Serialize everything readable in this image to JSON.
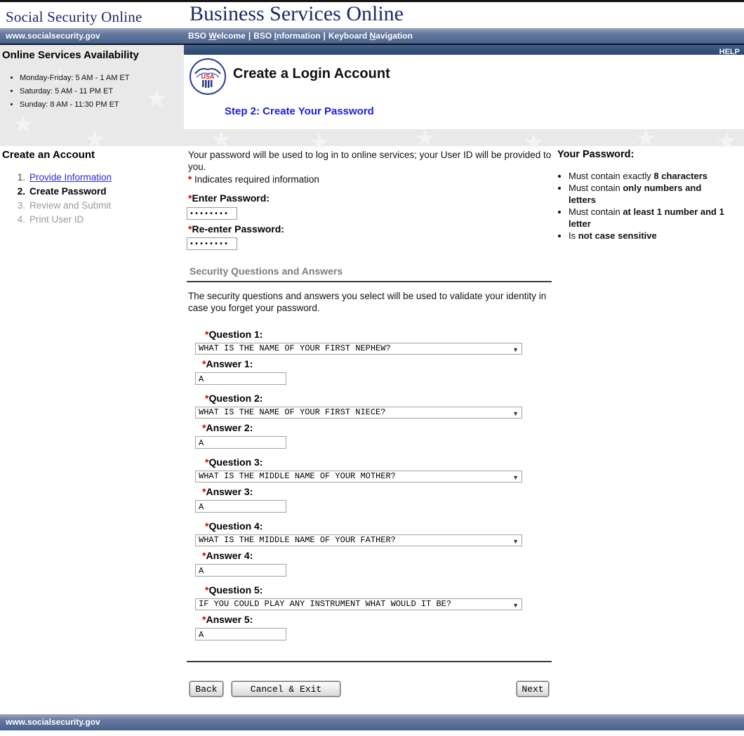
{
  "required_marker": "*",
  "header": {
    "site_name": "Social Security Online",
    "page_title": "Business Services Online",
    "site_url": "www.socialsecurity.gov",
    "nav_separator": "|",
    "nav_links": [
      {
        "pre": "BSO ",
        "key": "W",
        "post": "elcome"
      },
      {
        "pre": "BSO ",
        "key": "I",
        "post": "nformation"
      },
      {
        "pre": "Keyboard ",
        "key": "N",
        "post": "avigation"
      }
    ],
    "help_label": "HELP"
  },
  "availability": {
    "title": "Online Services Availability",
    "items": [
      "Monday-Friday: 5 AM - 1 AM ET",
      "Saturday: 5 AM - 11 PM ET",
      "Sunday: 8 AM - 11:30 PM ET"
    ]
  },
  "hero": {
    "title": "Create a Login Account",
    "step_title": "Step 2: Create Your Password",
    "seal_label": "USA"
  },
  "sidebar_steps": {
    "title": "Create an Account",
    "items": [
      {
        "num": "1.",
        "label": "Provide Information",
        "state": "link"
      },
      {
        "num": "2.",
        "label": "Create Password",
        "state": "current"
      },
      {
        "num": "3.",
        "label": "Review and Submit",
        "state": "future"
      },
      {
        "num": "4.",
        "label": "Print User ID",
        "state": "future"
      }
    ]
  },
  "main": {
    "intro": "Your password will be used to log in to online services; your User ID will be provided to you.",
    "required_note": " Indicates required information",
    "enter_password": {
      "label": "Enter Password:",
      "value": "••••••••"
    },
    "reenter_password": {
      "label": "Re-enter Password:",
      "value": "••••••••"
    },
    "security_section": {
      "title": "Security Questions and Answers",
      "description": "The security questions and answers you select will be used to validate your identity in case you forget your password."
    },
    "questions": [
      {
        "label": "Question 1:",
        "value": "WHAT IS THE NAME OF YOUR FIRST NEPHEW?",
        "answer_label": "Answer 1:",
        "answer_value": "A"
      },
      {
        "label": "Question 2:",
        "value": "WHAT IS THE NAME OF YOUR FIRST NIECE?",
        "answer_label": "Answer 2:",
        "answer_value": "A"
      },
      {
        "label": "Question 3:",
        "value": "WHAT IS THE MIDDLE NAME OF YOUR MOTHER?",
        "answer_label": "Answer 3:",
        "answer_value": "A"
      },
      {
        "label": "Question 4:",
        "value": "WHAT IS THE MIDDLE NAME OF YOUR FATHER?",
        "answer_label": "Answer 4:",
        "answer_value": "A"
      },
      {
        "label": "Question 5:",
        "value": "IF YOU COULD PLAY ANY INSTRUMENT WHAT WOULD IT BE?",
        "answer_label": "Answer 5:",
        "answer_value": "A"
      }
    ],
    "buttons": {
      "back": "Back",
      "cancel": "Cancel & Exit",
      "next": "Next"
    },
    "dropdown_arrow": "▼"
  },
  "right_rail": {
    "title": "Your Password:",
    "rules": [
      {
        "plain": "Must contain exactly ",
        "bold": "8 characters"
      },
      {
        "plain": "Must contain ",
        "bold": "only numbers and letters"
      },
      {
        "plain": "Must contain ",
        "bold": "at least 1 number and 1 letter"
      },
      {
        "plain": "Is ",
        "bold": "not case sensitive"
      }
    ]
  },
  "footer": {
    "site_url": "www.socialsecurity.gov"
  },
  "colors": {
    "navbar_blue": "#47648f",
    "help_bar_navy": "#33507c",
    "brand_navy": "#1b2a63",
    "step_title_blue": "#1c1ce0",
    "link_blue": "#2b2bd0",
    "asterisk_red": "#d40000",
    "hero_gray": "#e9e9e9"
  }
}
